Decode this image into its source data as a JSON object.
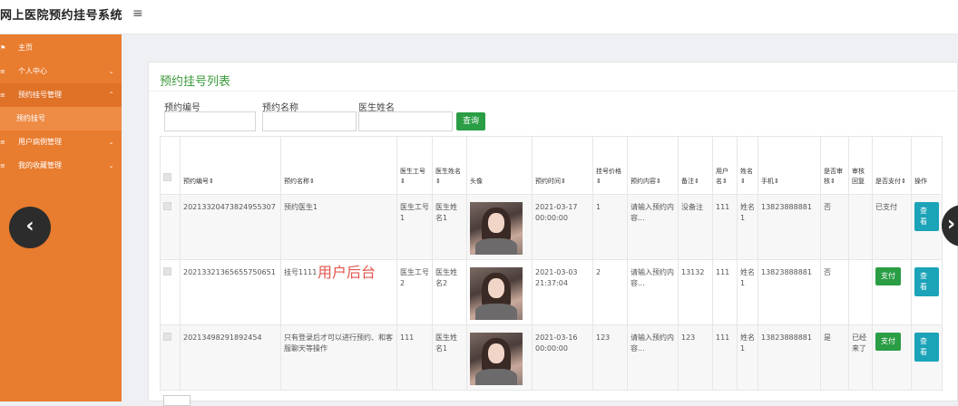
{
  "app": {
    "title": "网上医院预约挂号系统",
    "menu_toggle": "≡"
  },
  "sidebar": {
    "items": [
      {
        "label": "主页",
        "icon": "flag-icon",
        "glyph": "⚑",
        "chev": ""
      },
      {
        "label": "个人中心",
        "icon": "list-icon",
        "glyph": "≡",
        "chev": "⌄"
      },
      {
        "label": "预约挂号管理",
        "icon": "list-icon",
        "glyph": "≡",
        "chev": "⌃"
      },
      {
        "label": "预约挂号",
        "icon": "",
        "glyph": "",
        "chev": ""
      },
      {
        "label": "用户病例管理",
        "icon": "list-icon",
        "glyph": "≡",
        "chev": "⌄"
      },
      {
        "label": "我的收藏管理",
        "icon": "list-icon",
        "glyph": "≡",
        "chev": "⌄"
      }
    ]
  },
  "carousel": {
    "prev": "‹",
    "next": "›"
  },
  "panel": {
    "title": "预约挂号列表",
    "filters": {
      "f1": "预约编号",
      "f2": "预约名称",
      "f3": "医生姓名",
      "search_label": "查询"
    }
  },
  "table": {
    "headers": [
      "预约编号⇕",
      "预约名称⇕",
      "医生工号⇕",
      "医生姓名⇕",
      "头像",
      "预约时间⇕",
      "挂号价格⇕",
      "预约内容⇕",
      "备注⇕",
      "用户名⇕",
      "姓名⇕",
      "手机⇕",
      "是否审核⇕",
      "审核回复",
      "是否支付⇕",
      "操作"
    ],
    "rows": [
      {
        "id": "20213320473824955307",
        "name": "预约医生1",
        "doc_no": "医生工号1",
        "doc_name": "医生姓名1",
        "time": "2021-03-17 00:00:00",
        "price": "1",
        "content": "请输入预约内容...",
        "note": "没备注",
        "user": "111",
        "real": "姓名1",
        "phone": "13823888881",
        "audit": "否",
        "reply": "",
        "paid": "已支付",
        "pay_btn": "",
        "view": "查看"
      },
      {
        "id": "20213321365655750651",
        "name": "挂号1111",
        "doc_no": "医生工号2",
        "doc_name": "医生姓名2",
        "time": "2021-03-03 21:37:04",
        "price": "2",
        "content": "请输入预约内容...",
        "note": "13132",
        "user": "111",
        "real": "姓名1",
        "phone": "13823888881",
        "audit": "否",
        "reply": "",
        "paid": "",
        "pay_btn": "支付",
        "view": "查看"
      },
      {
        "id": "20213498291892454",
        "name": "只有登录后才可以进行预约、和客服聊天等操作",
        "doc_no": "111",
        "doc_name": "医生姓名1",
        "time": "2021-03-16 00:00:00",
        "price": "123",
        "content": "请输入预约内容...",
        "note": "123",
        "user": "111",
        "real": "姓名1",
        "phone": "13823888881",
        "audit": "是",
        "reply": "已经来了",
        "paid": "",
        "pay_btn": "支付",
        "view": "查看"
      }
    ]
  },
  "overlay": {
    "watermark": "用户后台"
  }
}
